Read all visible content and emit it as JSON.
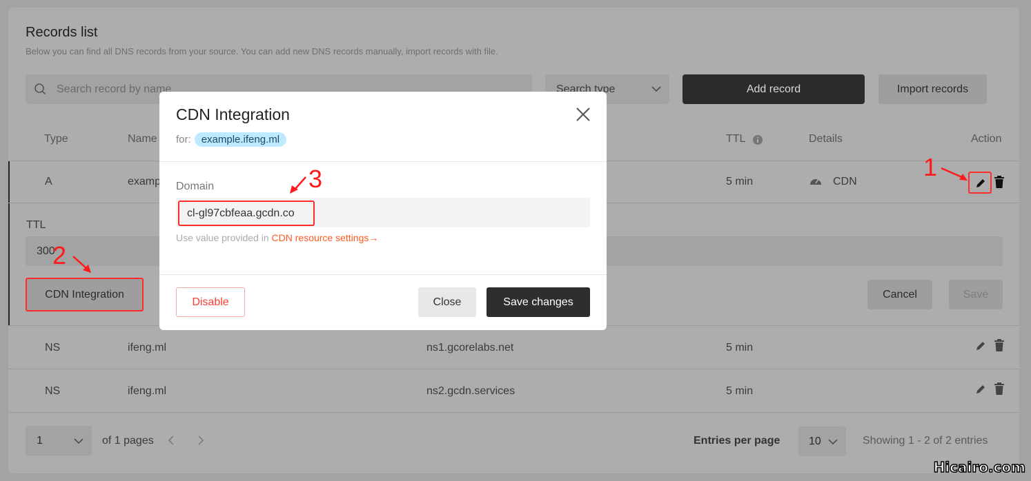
{
  "page": {
    "title": "Records list",
    "subtitle": "Below you can find all DNS records from your source. You can add new DNS records manually, import records with file."
  },
  "toolbar": {
    "search_placeholder": "Search record by name",
    "search_type": "Search type",
    "add_record": "Add record",
    "import_records": "Import records"
  },
  "table": {
    "headers": {
      "type": "Type",
      "name": "Name",
      "ttl": "TTL",
      "details": "Details",
      "action": "Action"
    },
    "rows": [
      {
        "type": "A",
        "name": "example.ifeng.ml",
        "value": "",
        "ttl": "5 min",
        "details": "CDN"
      },
      {
        "type": "NS",
        "name": "ifeng.ml",
        "value": "ns1.gcorelabs.net",
        "ttl": "5 min",
        "details": ""
      },
      {
        "type": "NS",
        "name": "ifeng.ml",
        "value": "ns2.gcdn.services",
        "ttl": "5 min",
        "details": ""
      }
    ]
  },
  "edit_panel": {
    "ttl_label": "TTL",
    "ttl_value": "300",
    "cdn_integration": "CDN Integration",
    "cancel": "Cancel",
    "save": "Save"
  },
  "pagination": {
    "page": "1",
    "of_pages": "of 1 pages",
    "entries_label": "Entries per page",
    "entries_value": "10",
    "showing": "Showing 1 - 2 of 2 entries"
  },
  "modal": {
    "title": "CDN Integration",
    "for_label": "for:",
    "domain_tag": "example.ifeng.ml",
    "domain_label": "Domain",
    "domain_value": "cl-gl97cbfeaa.gcdn.co",
    "hint": "Use value provided in",
    "hint_link": "CDN resource settings→",
    "disable": "Disable",
    "close": "Close",
    "save_changes": "Save changes"
  },
  "annotations": {
    "a1": "1",
    "a2": "2",
    "a3": "3"
  },
  "watermark": "Hicairo.com",
  "colors": {
    "accent_link": "#ff5a1f",
    "danger": "#ff3b30",
    "dark_button": "#2b2b2b",
    "tag_bg": "#bfe9ff",
    "annotation": "#ff1a1a"
  }
}
